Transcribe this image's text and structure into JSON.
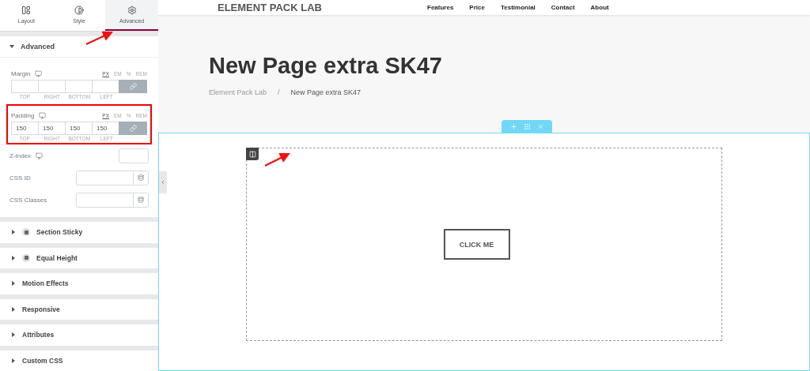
{
  "tabs": [
    {
      "label": "Layout",
      "selected": false
    },
    {
      "label": "Style",
      "selected": false
    },
    {
      "label": "Advanced",
      "selected": true
    }
  ],
  "advanced": {
    "title": "Advanced",
    "expanded": true,
    "margin": {
      "label": "Margin",
      "units": [
        {
          "label": "PX",
          "selected": true
        },
        {
          "label": "EM",
          "selected": false
        },
        {
          "label": "%",
          "selected": false
        },
        {
          "label": "REM",
          "selected": false
        }
      ],
      "fields": [
        {
          "label": "TOP"
        },
        {
          "label": "RIGHT"
        },
        {
          "label": "BOTTOM"
        },
        {
          "label": "LEFT"
        }
      ],
      "linked": true
    },
    "padding": {
      "label": "Padding",
      "units": [
        {
          "label": "PX",
          "selected": true
        },
        {
          "label": "EM",
          "selected": false
        },
        {
          "label": "%",
          "selected": false
        },
        {
          "label": "REM",
          "selected": false
        }
      ],
      "fields": [
        {
          "label": "TOP",
          "value": "150"
        },
        {
          "label": "RIGHT",
          "value": "150"
        },
        {
          "label": "BOTTOM",
          "value": "150"
        },
        {
          "label": "LEFT",
          "value": "150"
        }
      ],
      "linked": true,
      "highlighted": true
    },
    "z_index": {
      "label": "Z-Index"
    },
    "css_id": {
      "label": "CSS ID"
    },
    "css_classes": {
      "label": "CSS Classes"
    }
  },
  "sections": [
    {
      "title": "Section Sticky",
      "kind": "addon",
      "expanded": false
    },
    {
      "title": "Equal Height",
      "kind": "addon",
      "expanded": false
    },
    {
      "title": "Motion Effects",
      "kind": "plain",
      "expanded": false
    },
    {
      "title": "Responsive",
      "kind": "plain",
      "expanded": false
    },
    {
      "title": "Attributes",
      "kind": "plain",
      "expanded": false
    },
    {
      "title": "Custom CSS",
      "kind": "plain",
      "expanded": false
    }
  ],
  "site": {
    "logo": "ELEMENT PACK LAB",
    "nav": [
      "Features",
      "Price",
      "Testimonial",
      "Contact",
      "About"
    ],
    "page_title": "New Page extra SK47",
    "breadcrumb": [
      "Element Pack Lab",
      "/",
      "New Page extra SK47"
    ]
  },
  "canvas": {
    "button": "CLICK ME",
    "section_selected": true
  }
}
